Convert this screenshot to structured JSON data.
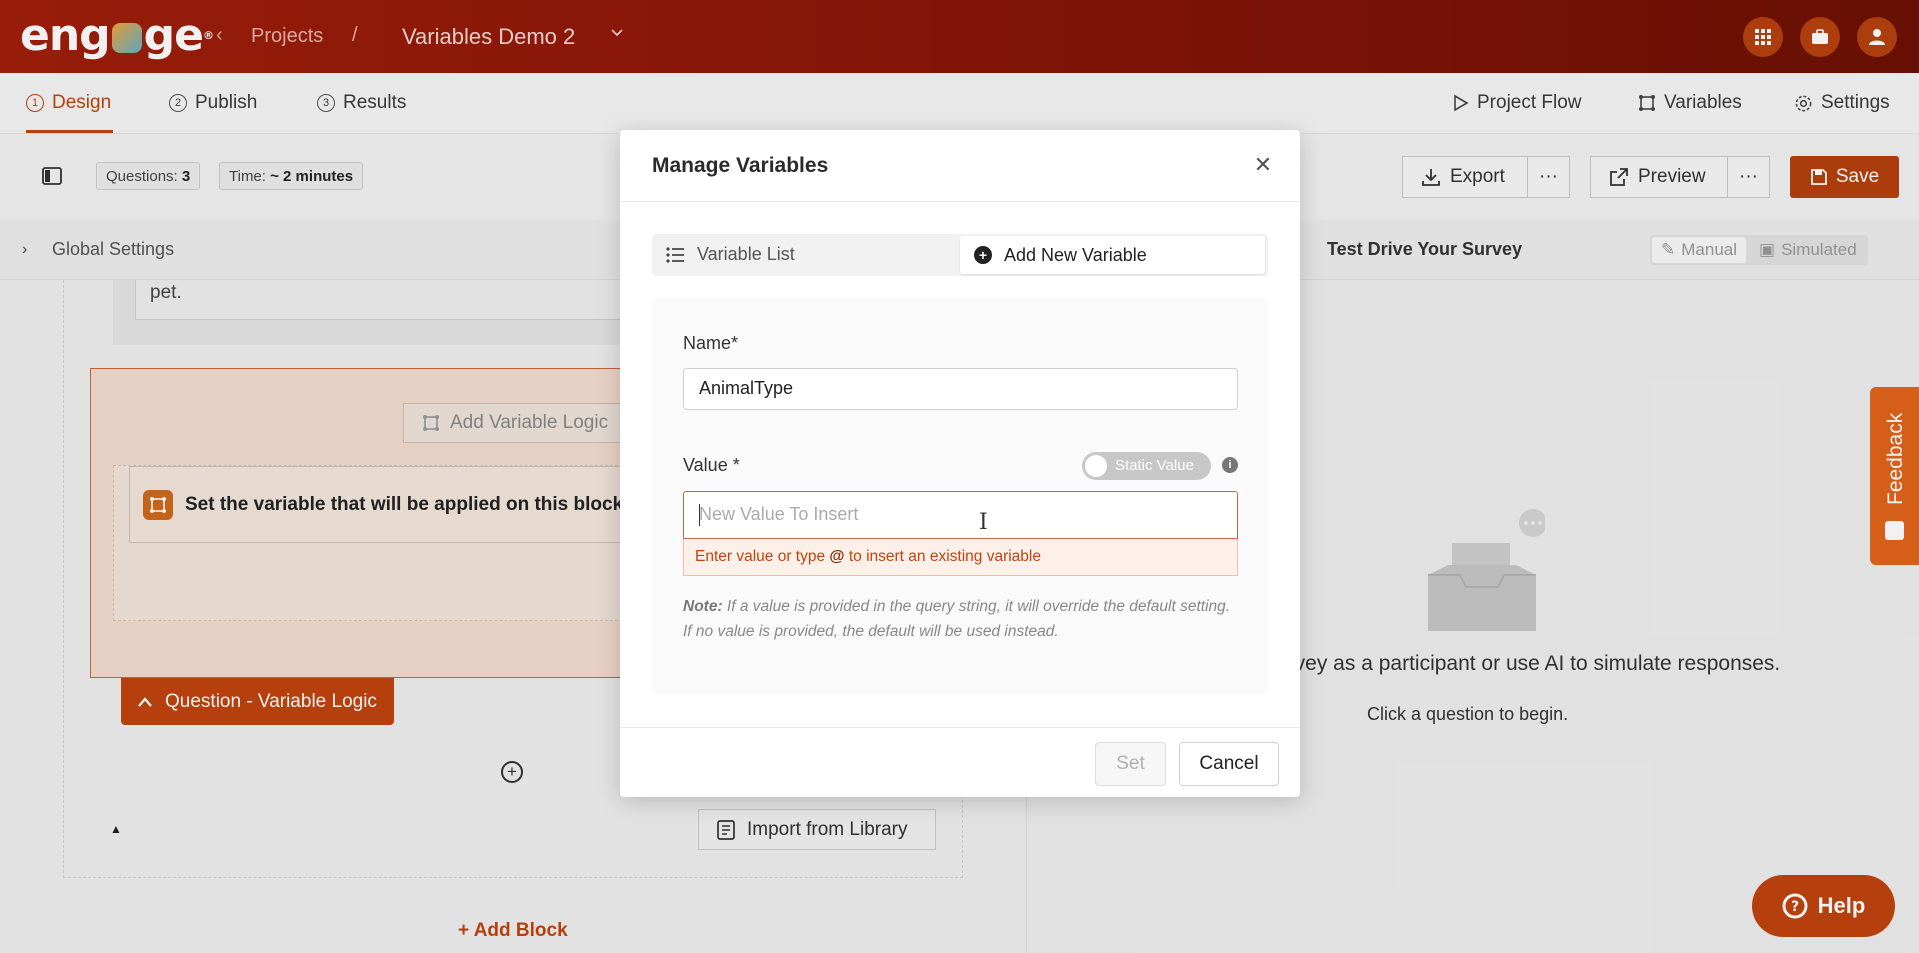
{
  "header": {
    "logo": "engage",
    "breadcrumb_projects": "Projects",
    "breadcrumb_sep": "/",
    "project_title": "Variables Demo 2",
    "icons": [
      "apps-grid-icon",
      "briefcase-icon",
      "user-icon"
    ]
  },
  "tabs": [
    {
      "num": "1",
      "label": "Design",
      "active": true
    },
    {
      "num": "2",
      "label": "Publish"
    },
    {
      "num": "3",
      "label": "Results"
    }
  ],
  "right_tabs": {
    "project_flow": "Project Flow",
    "variables": "Variables",
    "settings": "Settings"
  },
  "toolbar": {
    "questions_label": "Questions:",
    "questions_count": "3",
    "time_label": "Time:",
    "time_value": "~ 2 minutes",
    "export": "Export",
    "preview": "Preview",
    "save": "Save",
    "more": "···"
  },
  "global_settings": "Global Settings",
  "test_drive": {
    "title": "Test Drive Your Survey",
    "manual": "Manual",
    "simulated": "Simulated",
    "tail_text": "urvey as a participant or use AI to simulate responses.",
    "click_text": "Click a question to begin."
  },
  "canvas": {
    "question_text_tail": "pet.",
    "add_variable_logic": "Add Variable Logic",
    "set_variable_text": "Set the variable that will be applied on this block/q",
    "question_variable_logic": "Question - Variable Logic",
    "import_from_library": "Import from Library",
    "add_block": "Add Block"
  },
  "modal": {
    "title": "Manage Variables",
    "tab_list": "Variable List",
    "tab_add": "Add New Variable",
    "name_label": "Name*",
    "name_value": "AnimalType",
    "value_label": "Value *",
    "static_value": "Static Value",
    "value_placeholder": "New Value To Insert",
    "hint_pre": "Enter value or type ",
    "hint_at": "@",
    "hint_post": " to insert an existing variable",
    "note_label": "Note:",
    "note_text": " If a value is provided in the query string, it will override the default setting. If no value is provided, the default will be used instead.",
    "set": "Set",
    "cancel": "Cancel"
  },
  "feedback": "Feedback",
  "help": "Help",
  "colors": {
    "brand": "#c1440e",
    "header": "#8a1608"
  }
}
